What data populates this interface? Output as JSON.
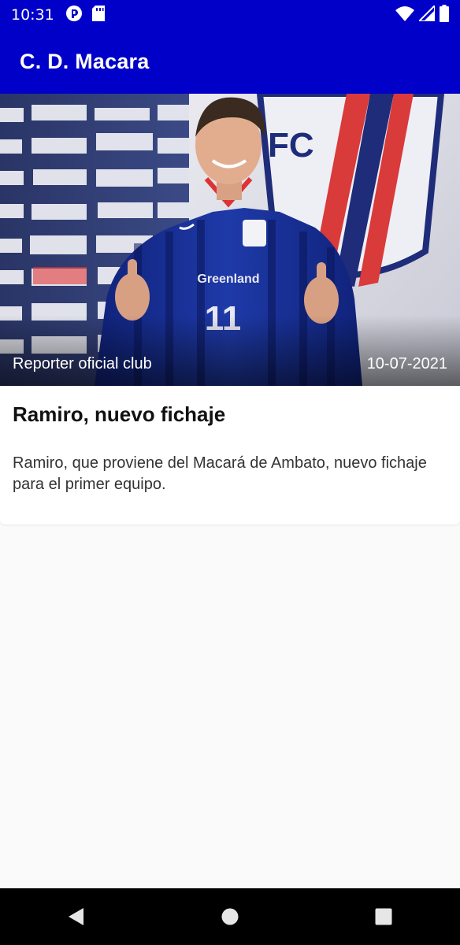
{
  "status_bar": {
    "time": "10:31",
    "left_icons": [
      "media-icon",
      "sd-card-icon"
    ],
    "right_icons": [
      "wifi-icon",
      "signal-icon",
      "battery-icon"
    ]
  },
  "app_bar": {
    "title": "C. D. Macara",
    "background_color": "#0000c8"
  },
  "news": [
    {
      "image_alt": "Jugador con camiseta azul número 11 levantando los pulgares",
      "author": "Reporter oficial club",
      "date": "10-07-2021",
      "title": "Ramiro, nuevo fichaje",
      "body": "Ramiro, que proviene del Macará de Ambato, nuevo fichaje para el primer equipo.",
      "jersey_text": "Greenland",
      "jersey_number": "11"
    }
  ],
  "nav_bar": {
    "icons": [
      "back-icon",
      "home-icon",
      "recents-icon"
    ]
  }
}
